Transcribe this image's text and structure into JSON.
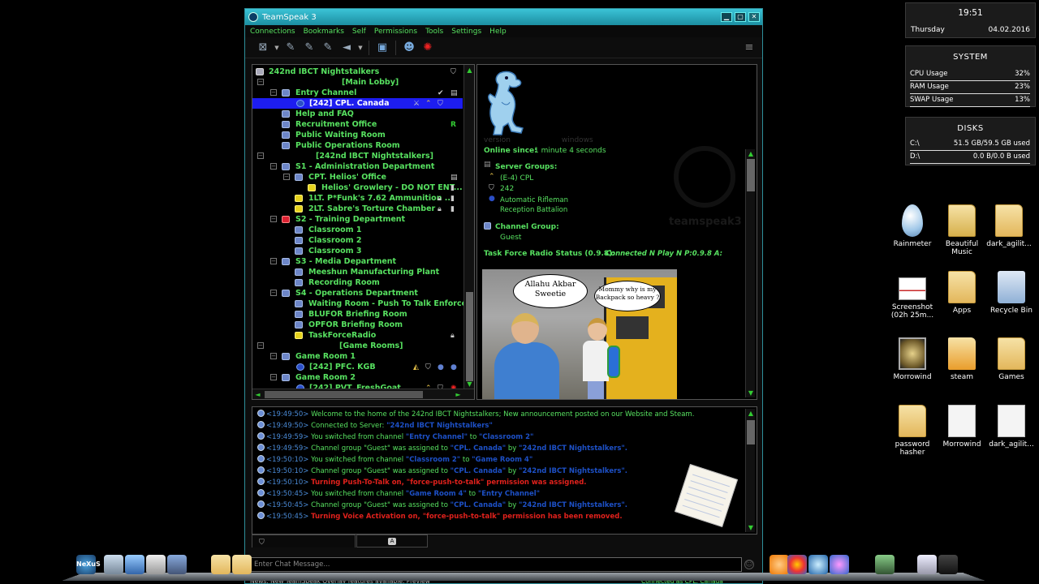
{
  "window": {
    "title": "TeamSpeak 3",
    "controls": {
      "minimize": "▁",
      "maximize": "▢",
      "close": "✕"
    }
  },
  "menu": [
    "Connections",
    "Bookmarks",
    "Self",
    "Permissions",
    "Tools",
    "Settings",
    "Help"
  ],
  "toolbar": {
    "icons": [
      "disconnect-icon",
      "connect-icon",
      "away-icon",
      "mute-microphone-icon",
      "mute-speakers-icon",
      "chat-icon",
      "contacts-icon",
      "teamspeak-red-icon",
      "hamburger-icon"
    ]
  },
  "tree": {
    "rows": [
      {
        "text": "242nd IBCT Nightstalkers",
        "type": "server"
      },
      {
        "text": "[Main Lobby]",
        "type": "spacer"
      },
      {
        "text": "Entry Channel",
        "type": "channel"
      },
      {
        "text": "[242] CPL. Canada",
        "type": "user",
        "selected": true
      },
      {
        "text": "Help and FAQ",
        "type": "channel"
      },
      {
        "text": "Recruitment Office",
        "type": "channel",
        "badge": "R"
      },
      {
        "text": "Public Waiting Room",
        "type": "channel"
      },
      {
        "text": "Public Operations Room",
        "type": "channel"
      },
      {
        "text": "[242nd IBCT Nightstalkers]",
        "type": "spacer"
      },
      {
        "text": "S1 - Administration Department",
        "type": "channel"
      },
      {
        "text": "CPT. Helios' Office",
        "type": "channel"
      },
      {
        "text": "Helios' Growlery - DO NOT ENT...",
        "type": "channel-yellow"
      },
      {
        "text": "1LT. P*Funk's 7.62 Ammunition ...",
        "type": "channel-yellow"
      },
      {
        "text": "2LT. Sabre's Torture Chamber",
        "type": "channel-yellow"
      },
      {
        "text": "S2 - Training Department",
        "type": "channel-red"
      },
      {
        "text": "Classroom 1",
        "type": "channel"
      },
      {
        "text": "Classroom 2",
        "type": "channel"
      },
      {
        "text": "Classroom 3",
        "type": "channel"
      },
      {
        "text": "S3 - Media Department",
        "type": "channel"
      },
      {
        "text": "Meeshun Manufacturing Plant",
        "type": "channel"
      },
      {
        "text": "Recording Room",
        "type": "channel"
      },
      {
        "text": "S4 - Operations Department",
        "type": "channel"
      },
      {
        "text": "Waiting Room - Push To Talk Enforced",
        "type": "channel"
      },
      {
        "text": "BLUFOR Briefing Room",
        "type": "channel"
      },
      {
        "text": "OPFOR Briefing Room",
        "type": "channel"
      },
      {
        "text": "TaskForceRadio",
        "type": "channel-yellow"
      },
      {
        "text": "[Game Rooms]",
        "type": "spacer"
      },
      {
        "text": "Game Room 1",
        "type": "channel"
      },
      {
        "text": "[242] PFC. KGB",
        "type": "user"
      },
      {
        "text": "Game Room 2",
        "type": "channel"
      },
      {
        "text": "[242] PVT. FreshGoat",
        "type": "user"
      }
    ]
  },
  "info": {
    "online_label": "Online since:",
    "online_value": "1 minute 4 seconds",
    "server_groups_label": "Server Groups:",
    "server_groups": [
      "(E-4) CPL",
      "242",
      "Automatic Rifleman",
      "Reception  Battalion"
    ],
    "channel_group_label": "Channel Group:",
    "channel_group": "Guest",
    "tfr_label": "Task Force Radio Status (0.9.8):",
    "tfr_value": "Connected N Play N P:0.9.8 A:",
    "meme_text_a": "Allahu Akbar Sweetie",
    "meme_text_b": "Mommy why is my Backpack so heavy ?",
    "logo_word": "teamspeak3"
  },
  "chat": {
    "lines": [
      {
        "time": "<19:49:50>",
        "parts": [
          {
            "t": "Welcome to the home of the 242nd IBCT Nightstalkers; New announcement posted on our Website and Steam.",
            "c": "msg"
          }
        ]
      },
      {
        "time": "<19:49:50>",
        "parts": [
          {
            "t": "Connected to Server: ",
            "c": "msg"
          },
          {
            "t": "\"242nd IBCT Nightstalkers\"",
            "c": "hl"
          }
        ]
      },
      {
        "time": "<19:49:59>",
        "parts": [
          {
            "t": "You switched from channel ",
            "c": "msg"
          },
          {
            "t": "\"Entry Channel\"",
            "c": "hl"
          },
          {
            "t": " to ",
            "c": "msg"
          },
          {
            "t": "\"Classroom 2\"",
            "c": "hl"
          }
        ]
      },
      {
        "time": "<19:49:59>",
        "parts": [
          {
            "t": "Channel group \"Guest\" was assigned to ",
            "c": "msg"
          },
          {
            "t": "\"CPL. Canada\"",
            "c": "hl"
          },
          {
            "t": " by ",
            "c": "msg"
          },
          {
            "t": "\"242nd IBCT Nightstalkers\".",
            "c": "hl"
          }
        ]
      },
      {
        "time": "<19:50:10>",
        "parts": [
          {
            "t": "You switched from channel ",
            "c": "msg"
          },
          {
            "t": "\"Classroom 2\"",
            "c": "hl"
          },
          {
            "t": " to ",
            "c": "msg"
          },
          {
            "t": "\"Game Room 4\"",
            "c": "hl"
          }
        ]
      },
      {
        "time": "<19:50:10>",
        "parts": [
          {
            "t": "Channel group \"Guest\" was assigned to ",
            "c": "msg"
          },
          {
            "t": "\"CPL. Canada\"",
            "c": "hl"
          },
          {
            "t": " by ",
            "c": "msg"
          },
          {
            "t": "\"242nd IBCT Nightstalkers\".",
            "c": "hl"
          }
        ]
      },
      {
        "time": "<19:50:10>",
        "red": true,
        "parts": [
          {
            "t": "Turning Push-To-Talk on, \"force-push-to-talk\" permission was assigned.",
            "c": "msg"
          }
        ]
      },
      {
        "time": "<19:50:45>",
        "parts": [
          {
            "t": "You switched from channel ",
            "c": "msg"
          },
          {
            "t": "\"Game Room 4\"",
            "c": "hl"
          },
          {
            "t": " to ",
            "c": "msg"
          },
          {
            "t": "\"Entry Channel\"",
            "c": "hl"
          }
        ]
      },
      {
        "time": "<19:50:45>",
        "parts": [
          {
            "t": "Channel group \"Guest\" was assigned to ",
            "c": "msg"
          },
          {
            "t": "\"CPL. Canada\"",
            "c": "hl"
          },
          {
            "t": " by ",
            "c": "msg"
          },
          {
            "t": "\"242nd IBCT Nightstalkers\".",
            "c": "hl"
          }
        ]
      },
      {
        "time": "<19:50:45>",
        "red": true,
        "parts": [
          {
            "t": "Turning Voice Activation on, \"force-push-to-talk\" permission has been removed.",
            "c": "msg"
          }
        ]
      }
    ],
    "tab_server": "",
    "tab_channel": "A",
    "input_placeholder": "Enter Chat Message...",
    "news": "News: New TeamSpeak Overlay features available. Preview",
    "connection_status": "Connected as CPL. Canada"
  },
  "desktop": {
    "clock": {
      "time": "19:51",
      "day": "Thursday",
      "date": "04.02.2016"
    },
    "system": {
      "title": "SYSTEM",
      "rows": [
        {
          "label": "CPU Usage",
          "value": "32%"
        },
        {
          "label": "RAM Usage",
          "value": "23%"
        },
        {
          "label": "SWAP Usage",
          "value": "13%"
        }
      ]
    },
    "disks": {
      "title": "DISKS",
      "rows": [
        {
          "label": "C:\\",
          "value": "51.5 GB/59.5 GB used"
        },
        {
          "label": "D:\\",
          "value": "0.0 B/0.0 B used"
        }
      ]
    },
    "icons": [
      {
        "label": "Rainmeter",
        "kind": "drop"
      },
      {
        "label": "Beautiful Music",
        "kind": "musicf"
      },
      {
        "label": "dark_agilit...",
        "kind": "folder"
      },
      {
        "label": "Screenshot (02h 25m...",
        "kind": "shot"
      },
      {
        "label": "Apps",
        "kind": "folder"
      },
      {
        "label": "Recycle Bin",
        "kind": "bin"
      },
      {
        "label": "Morrowind",
        "kind": "morro"
      },
      {
        "label": "steam",
        "kind": "steamf"
      },
      {
        "label": "Games",
        "kind": "folder"
      },
      {
        "label": "password hasher",
        "kind": "folder"
      },
      {
        "label": "Morrowind",
        "kind": "doc"
      },
      {
        "label": "dark_agilit...",
        "kind": "doc"
      }
    ],
    "dock_brand": "NeXuS"
  }
}
